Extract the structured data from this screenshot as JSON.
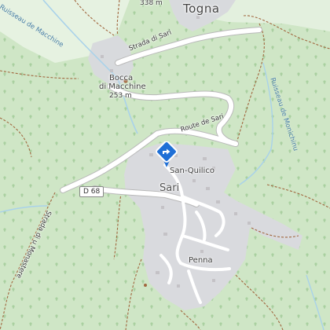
{
  "labels": {
    "togna": "Togna",
    "togna_elev": "338 m",
    "strada_di_sari": "Strada di Sari",
    "bocca_line1": "Bocca",
    "bocca_line2": "di Macchine",
    "bocca_elev": "253 m",
    "route_de_sari": "Route de Sari",
    "d68": "D 68",
    "san_quilico": "San-Quilico",
    "sari": "Sari",
    "penna": "Penna",
    "ruisseau_macchine": "Ruisseau de Macchine",
    "ruisseau_monichinu": "Ruisseau de Monichinu",
    "strada_monastere": "Strada di u Monastere"
  },
  "marker": {
    "icon": "direction-diamond-icon",
    "color": "#1f6fd6"
  },
  "colors": {
    "forest": "#cfe6c6",
    "meadow": "#e9f4e4",
    "settlement": "#d9dade",
    "road": "#ffffff",
    "stream": "#a9d2ea",
    "path": "#a1673f"
  }
}
